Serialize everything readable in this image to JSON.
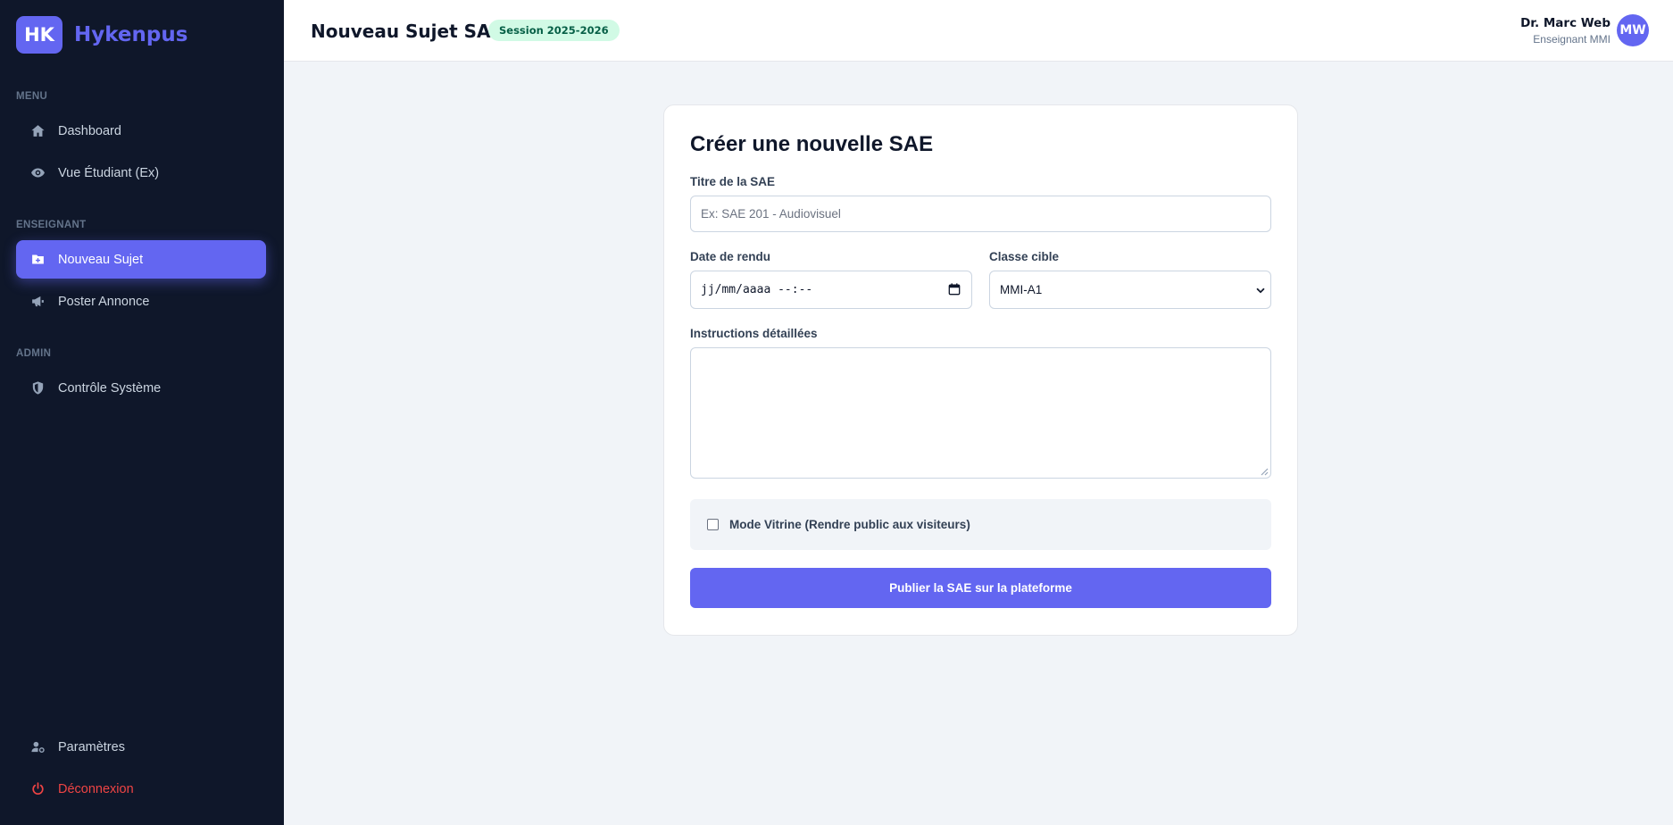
{
  "brand": {
    "logo_text": "HK",
    "name": "Hykenpus"
  },
  "sidebar": {
    "sections": {
      "menu": "MENU",
      "enseignant": "ENSEIGNANT",
      "admin": "ADMIN"
    },
    "items": [
      {
        "label": "Dashboard",
        "icon": "home-icon"
      },
      {
        "label": "Vue Étudiant (Ex)",
        "icon": "eye-icon"
      },
      {
        "label": "Nouveau Sujet",
        "icon": "folder-plus-icon",
        "active": true
      },
      {
        "label": "Poster Annonce",
        "icon": "megaphone-icon"
      },
      {
        "label": "Contrôle Système",
        "icon": "shield-icon"
      },
      {
        "label": "Paramètres",
        "icon": "user-cog-icon"
      },
      {
        "label": "Déconnexion",
        "icon": "power-icon"
      }
    ]
  },
  "header": {
    "title": "Nouveau Sujet SAE",
    "session_badge": "Session 2025-2026",
    "user": {
      "name": "Dr. Marc Web",
      "role": "Enseignant MMI",
      "initials": "MW"
    }
  },
  "form": {
    "title": "Créer une nouvelle SAE",
    "titre_label": "Titre de la SAE",
    "titre_placeholder": "Ex: SAE 201 - Audiovisuel",
    "date_label": "Date de rendu",
    "date_placeholder": "jj/mm/aaaa --:--",
    "classe_label": "Classe cible",
    "classe_value": "MMI-A1",
    "instructions_label": "Instructions détaillées",
    "instructions_value": "",
    "vitrine_label": "Mode Vitrine (Rendre public aux visiteurs)",
    "vitrine_checked": false,
    "publish_label": "Publier la SAE sur la plateforme"
  },
  "colors": {
    "sidebar_bg": "#0f172a",
    "accent": "#6366f1",
    "danger": "#ef4444",
    "badge_bg": "#d1fae5",
    "badge_text": "#065f46",
    "page_bg": "#f1f4f8"
  }
}
